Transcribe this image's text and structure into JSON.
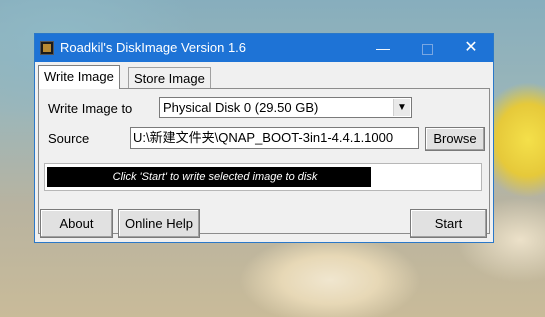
{
  "window": {
    "title": "Roadkil's DiskImage Version 1.6",
    "minimize_glyph": "—",
    "close_glyph": "✕"
  },
  "tabs": [
    {
      "label": "Write Image",
      "active": true
    },
    {
      "label": "Store Image",
      "active": false
    }
  ],
  "write_image": {
    "target_label": "Write Image to",
    "target_value": "Physical Disk 0 (29.50 GB)",
    "source_label": "Source",
    "source_value": "U:\\新建文件夹\\QNAP_BOOT-3in1-4.4.1.1000",
    "browse_label": "Browse"
  },
  "progress": {
    "text": "Click 'Start' to write selected image to disk",
    "fraction": 0.75
  },
  "buttons": {
    "about": "About",
    "help": "Online Help",
    "start": "Start"
  },
  "colors": {
    "titlebar": "#1e73d6",
    "progress_fill": "#000000"
  },
  "icons": {
    "app": "disk-image-app-icon",
    "dropdown": "chevron-down-icon"
  }
}
